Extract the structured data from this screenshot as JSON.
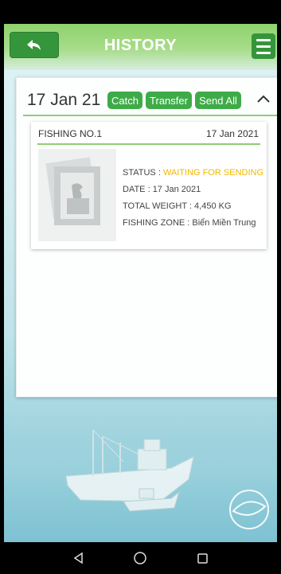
{
  "header": {
    "title": "HISTORY",
    "back_icon": "back-arrow-icon",
    "menu_icon": "hamburger-menu-icon"
  },
  "group": {
    "date": "17 Jan 21",
    "actions": {
      "catch_label": "Catch",
      "transfer_label": "Transfer",
      "send_all_label": "Send All"
    },
    "collapse_icon": "chevron-up-icon"
  },
  "records": [
    {
      "title": "FISHING NO.1",
      "date": "17 Jan 2021",
      "status_label": "STATUS : ",
      "status_value": "WAITING FOR SENDING",
      "date_line": "DATE : 17 Jan 2021",
      "weight_line": "TOTAL WEIGHT : 4,450 KG",
      "zone_line": "FISHING ZONE : Biển Miền Trung"
    }
  ],
  "colors": {
    "accent_green": "#3eab48",
    "header_green": "#8fd26d",
    "status_yellow": "#f1b900"
  },
  "nav": {
    "back_icon": "triangle-back-icon",
    "home_icon": "circle-home-icon",
    "recents_icon": "square-recents-icon"
  }
}
